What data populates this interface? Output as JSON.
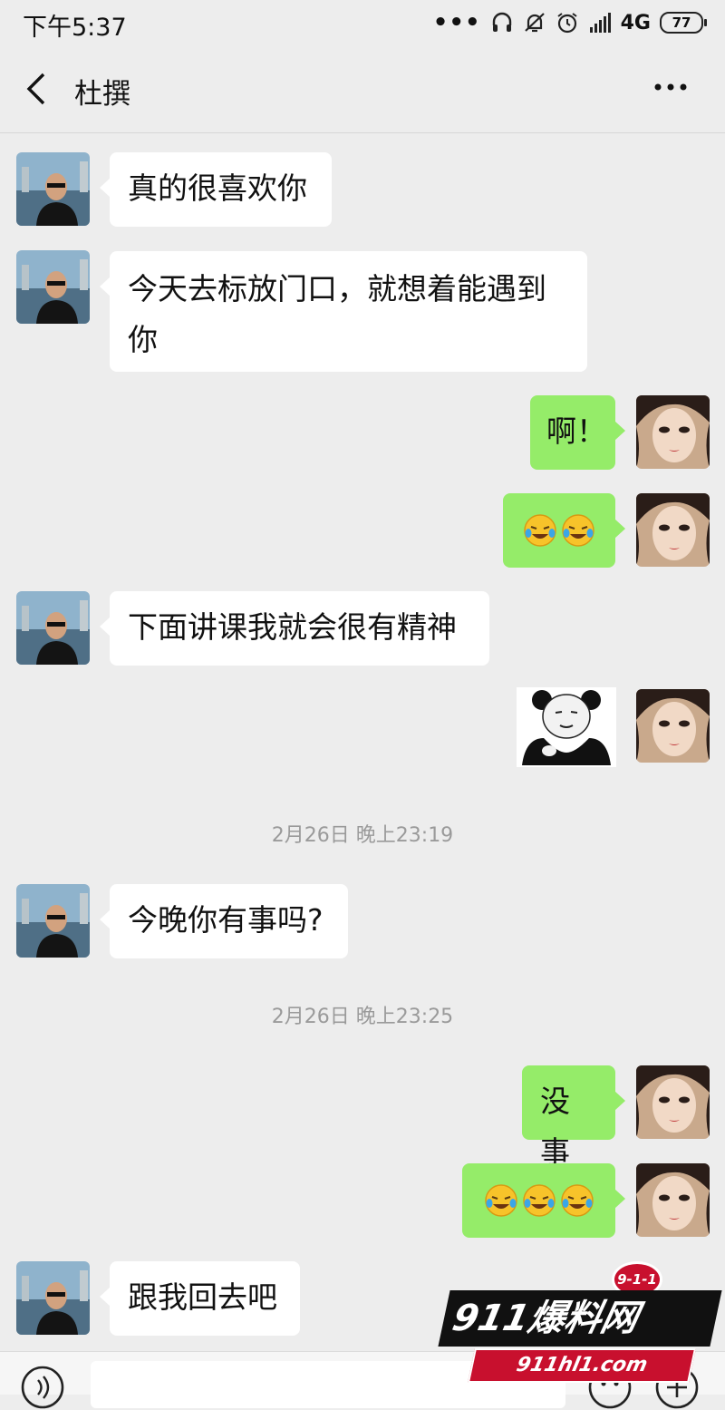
{
  "status_bar": {
    "time": "下午5:37",
    "network": "4G",
    "battery": "77",
    "icons": [
      "more-dots-icon",
      "headset-icon",
      "bell-muted-icon",
      "alarm-icon",
      "signal-icon",
      "battery-icon"
    ]
  },
  "header": {
    "title": "杜撰",
    "back_icon": "chevron-left-icon",
    "more_icon": "more-dots-icon"
  },
  "messages": [
    {
      "side": "in",
      "type": "text",
      "text": "真的很喜欢你"
    },
    {
      "side": "in",
      "type": "text",
      "text": "今天去标放门口，就想着能遇到你"
    },
    {
      "side": "out",
      "type": "text",
      "text": "啊！"
    },
    {
      "side": "out",
      "type": "emoji",
      "emoji": "laugh-cry-emoji",
      "count": 2
    },
    {
      "side": "in",
      "type": "text",
      "text": "下面讲课我就会很有精神"
    },
    {
      "side": "out",
      "type": "sticker",
      "sticker": "panda-meme-sticker"
    },
    {
      "type": "timestamp",
      "text": "2月26日 晚上23:19"
    },
    {
      "side": "in",
      "type": "text",
      "text": "今晚你有事吗?"
    },
    {
      "type": "timestamp",
      "text": "2月26日 晚上23:25"
    },
    {
      "side": "out",
      "type": "text",
      "text": "没事"
    },
    {
      "side": "out",
      "type": "emoji",
      "emoji": "laugh-cry-emoji",
      "count": 3
    },
    {
      "side": "in",
      "type": "text",
      "text": "跟我回去吧"
    }
  ],
  "msg_text": {
    "m1": "真的很喜欢你",
    "m2_line1": "今天去标放门口，就想着能遇到",
    "m2_line2": "你",
    "m3": "啊！",
    "m5": "下面讲课我就会很有精神",
    "ts1": "2月26日 晚上23:19",
    "m7": "今晚你有事吗?",
    "ts2": "2月26日 晚上23:25",
    "m8": "没事",
    "m10": "跟我回去吧"
  },
  "input_bar": {
    "value": "",
    "icons": [
      "voice-icon",
      "smile-icon",
      "plus-icon"
    ]
  },
  "watermark": {
    "badge": "9-1-1",
    "title": "911爆料网",
    "url": "911hl1.com"
  },
  "colors": {
    "background": "#ededed",
    "incoming_bubble": "#ffffff",
    "outgoing_bubble": "#95ec69",
    "timestamp": "#9a9a9a",
    "watermark_red": "#c8102e"
  }
}
